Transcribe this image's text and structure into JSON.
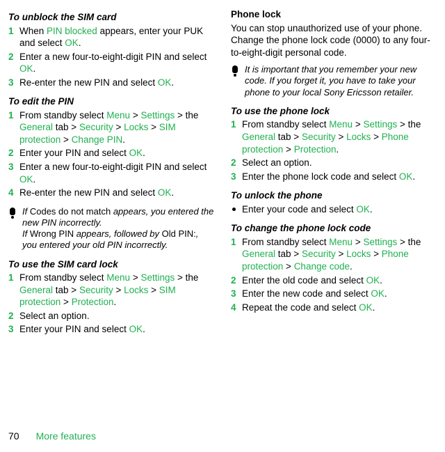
{
  "left": {
    "unblock": {
      "title": "To unblock the SIM card",
      "steps": [
        {
          "n": "1",
          "pre": "When ",
          "cmd1": "PIN blocked",
          "mid": " appears, enter your PUK and select ",
          "cmd2": "OK",
          "post": "."
        },
        {
          "n": "2",
          "text_a": "Enter a new four-to-eight-digit PIN and select ",
          "cmd": "OK",
          "post": "."
        },
        {
          "n": "3",
          "text_a": "Re-enter the new PIN and select ",
          "cmd": "OK",
          "post": "."
        }
      ]
    },
    "edit": {
      "title": "To edit the PIN",
      "steps": [
        {
          "n": "1",
          "pre": "From standby select ",
          "cmd1": "Menu",
          "g1": " > ",
          "cmd2": "Settings",
          "g2": " > the ",
          "cmd3": "General",
          "g3": " tab > ",
          "cmd4": "Security",
          "g4": " > ",
          "cmd5": "Locks",
          "g5": " > ",
          "cmd6": "SIM protection",
          "g6": " > ",
          "cmd7": "Change PIN",
          "post": "."
        },
        {
          "n": "2",
          "text_a": "Enter your PIN and select ",
          "cmd": "OK",
          "post": "."
        },
        {
          "n": "3",
          "text_a": "Enter a new four-to-eight-digit PIN and select ",
          "cmd": "OK",
          "post": "."
        },
        {
          "n": "4",
          "text_a": "Re-enter the new PIN and select ",
          "cmd": "OK",
          "post": "."
        }
      ]
    },
    "note": {
      "l1a": "If ",
      "l1b": "Codes do not match",
      "l1c": " appears, you entered the new PIN incorrectly.",
      "l2a": "If ",
      "l2b": "Wrong PIN",
      "l2c": " appears, followed by ",
      "l2d": "Old PIN:",
      "l2e": ", you entered your old PIN incorrectly."
    },
    "simlock": {
      "title": "To use the SIM card lock",
      "steps": [
        {
          "n": "1",
          "pre": "From standby select ",
          "cmd1": "Menu",
          "g1": " > ",
          "cmd2": "Settings",
          "g2": " > the ",
          "cmd3": "General",
          "g3": " tab > ",
          "cmd4": "Security",
          "g4": " > ",
          "cmd5": "Locks",
          "g5": " > ",
          "cmd6": "SIM protection",
          "g6": " > ",
          "cmd7": "Protection",
          "post": "."
        },
        {
          "n": "2",
          "text_a": "Select an option."
        },
        {
          "n": "3",
          "text_a": "Enter your PIN and select ",
          "cmd": "OK",
          "post": "."
        }
      ]
    }
  },
  "right": {
    "phonelock": {
      "title": "Phone lock",
      "para": "You can stop unauthorized use of your phone. Change the phone lock code (0000) to any four-to-eight-digit personal code."
    },
    "note": {
      "text": "It is important that you remember your new code. If you forget it, you have to take your phone to your local Sony Ericsson retailer."
    },
    "use": {
      "title": "To use the phone lock",
      "steps": [
        {
          "n": "1",
          "pre": "From standby select ",
          "cmd1": "Menu",
          "g1": " > ",
          "cmd2": "Settings",
          "g2": " > the ",
          "cmd3": "General",
          "g3": " tab > ",
          "cmd4": "Security",
          "g4": " > ",
          "cmd5": "Locks",
          "g5": " > ",
          "cmd6": "Phone protection",
          "g6": " > ",
          "cmd7": "Protection",
          "post": "."
        },
        {
          "n": "2",
          "text_a": "Select an option."
        },
        {
          "n": "3",
          "text_a": "Enter the phone lock code and select ",
          "cmd": "OK",
          "post": "."
        }
      ]
    },
    "unlock": {
      "title": "To unlock the phone",
      "item": {
        "text_a": "Enter your code and select ",
        "cmd": "OK",
        "post": "."
      }
    },
    "change": {
      "title": "To change the phone lock code",
      "steps": [
        {
          "n": "1",
          "pre": "From standby select ",
          "cmd1": "Menu",
          "g1": " > ",
          "cmd2": "Settings",
          "g2": " > the ",
          "cmd3": "General",
          "g3": " tab > ",
          "cmd4": "Security",
          "g4": " > ",
          "cmd5": "Locks",
          "g5": " > ",
          "cmd6": "Phone protection",
          "g6": " > ",
          "cmd7": "Change code",
          "post": "."
        },
        {
          "n": "2",
          "text_a": "Enter the old code and select ",
          "cmd": "OK",
          "post": "."
        },
        {
          "n": "3",
          "text_a": "Enter the new code and select ",
          "cmd": "OK",
          "post": "."
        },
        {
          "n": "4",
          "text_a": "Repeat the code and select ",
          "cmd": "OK",
          "post": "."
        }
      ]
    }
  },
  "footer": {
    "page": "70",
    "section": "More features"
  }
}
